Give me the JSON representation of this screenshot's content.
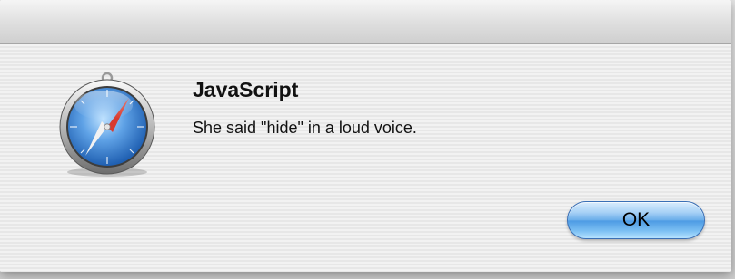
{
  "dialog": {
    "title": "JavaScript",
    "message": "She said \"hide\" in a loud voice.",
    "ok_label": "OK",
    "icon": "safari-compass-icon"
  },
  "colors": {
    "button_accent": "#6aaeea",
    "compass_blue": "#2f74c8",
    "compass_red": "#d83a2e"
  }
}
